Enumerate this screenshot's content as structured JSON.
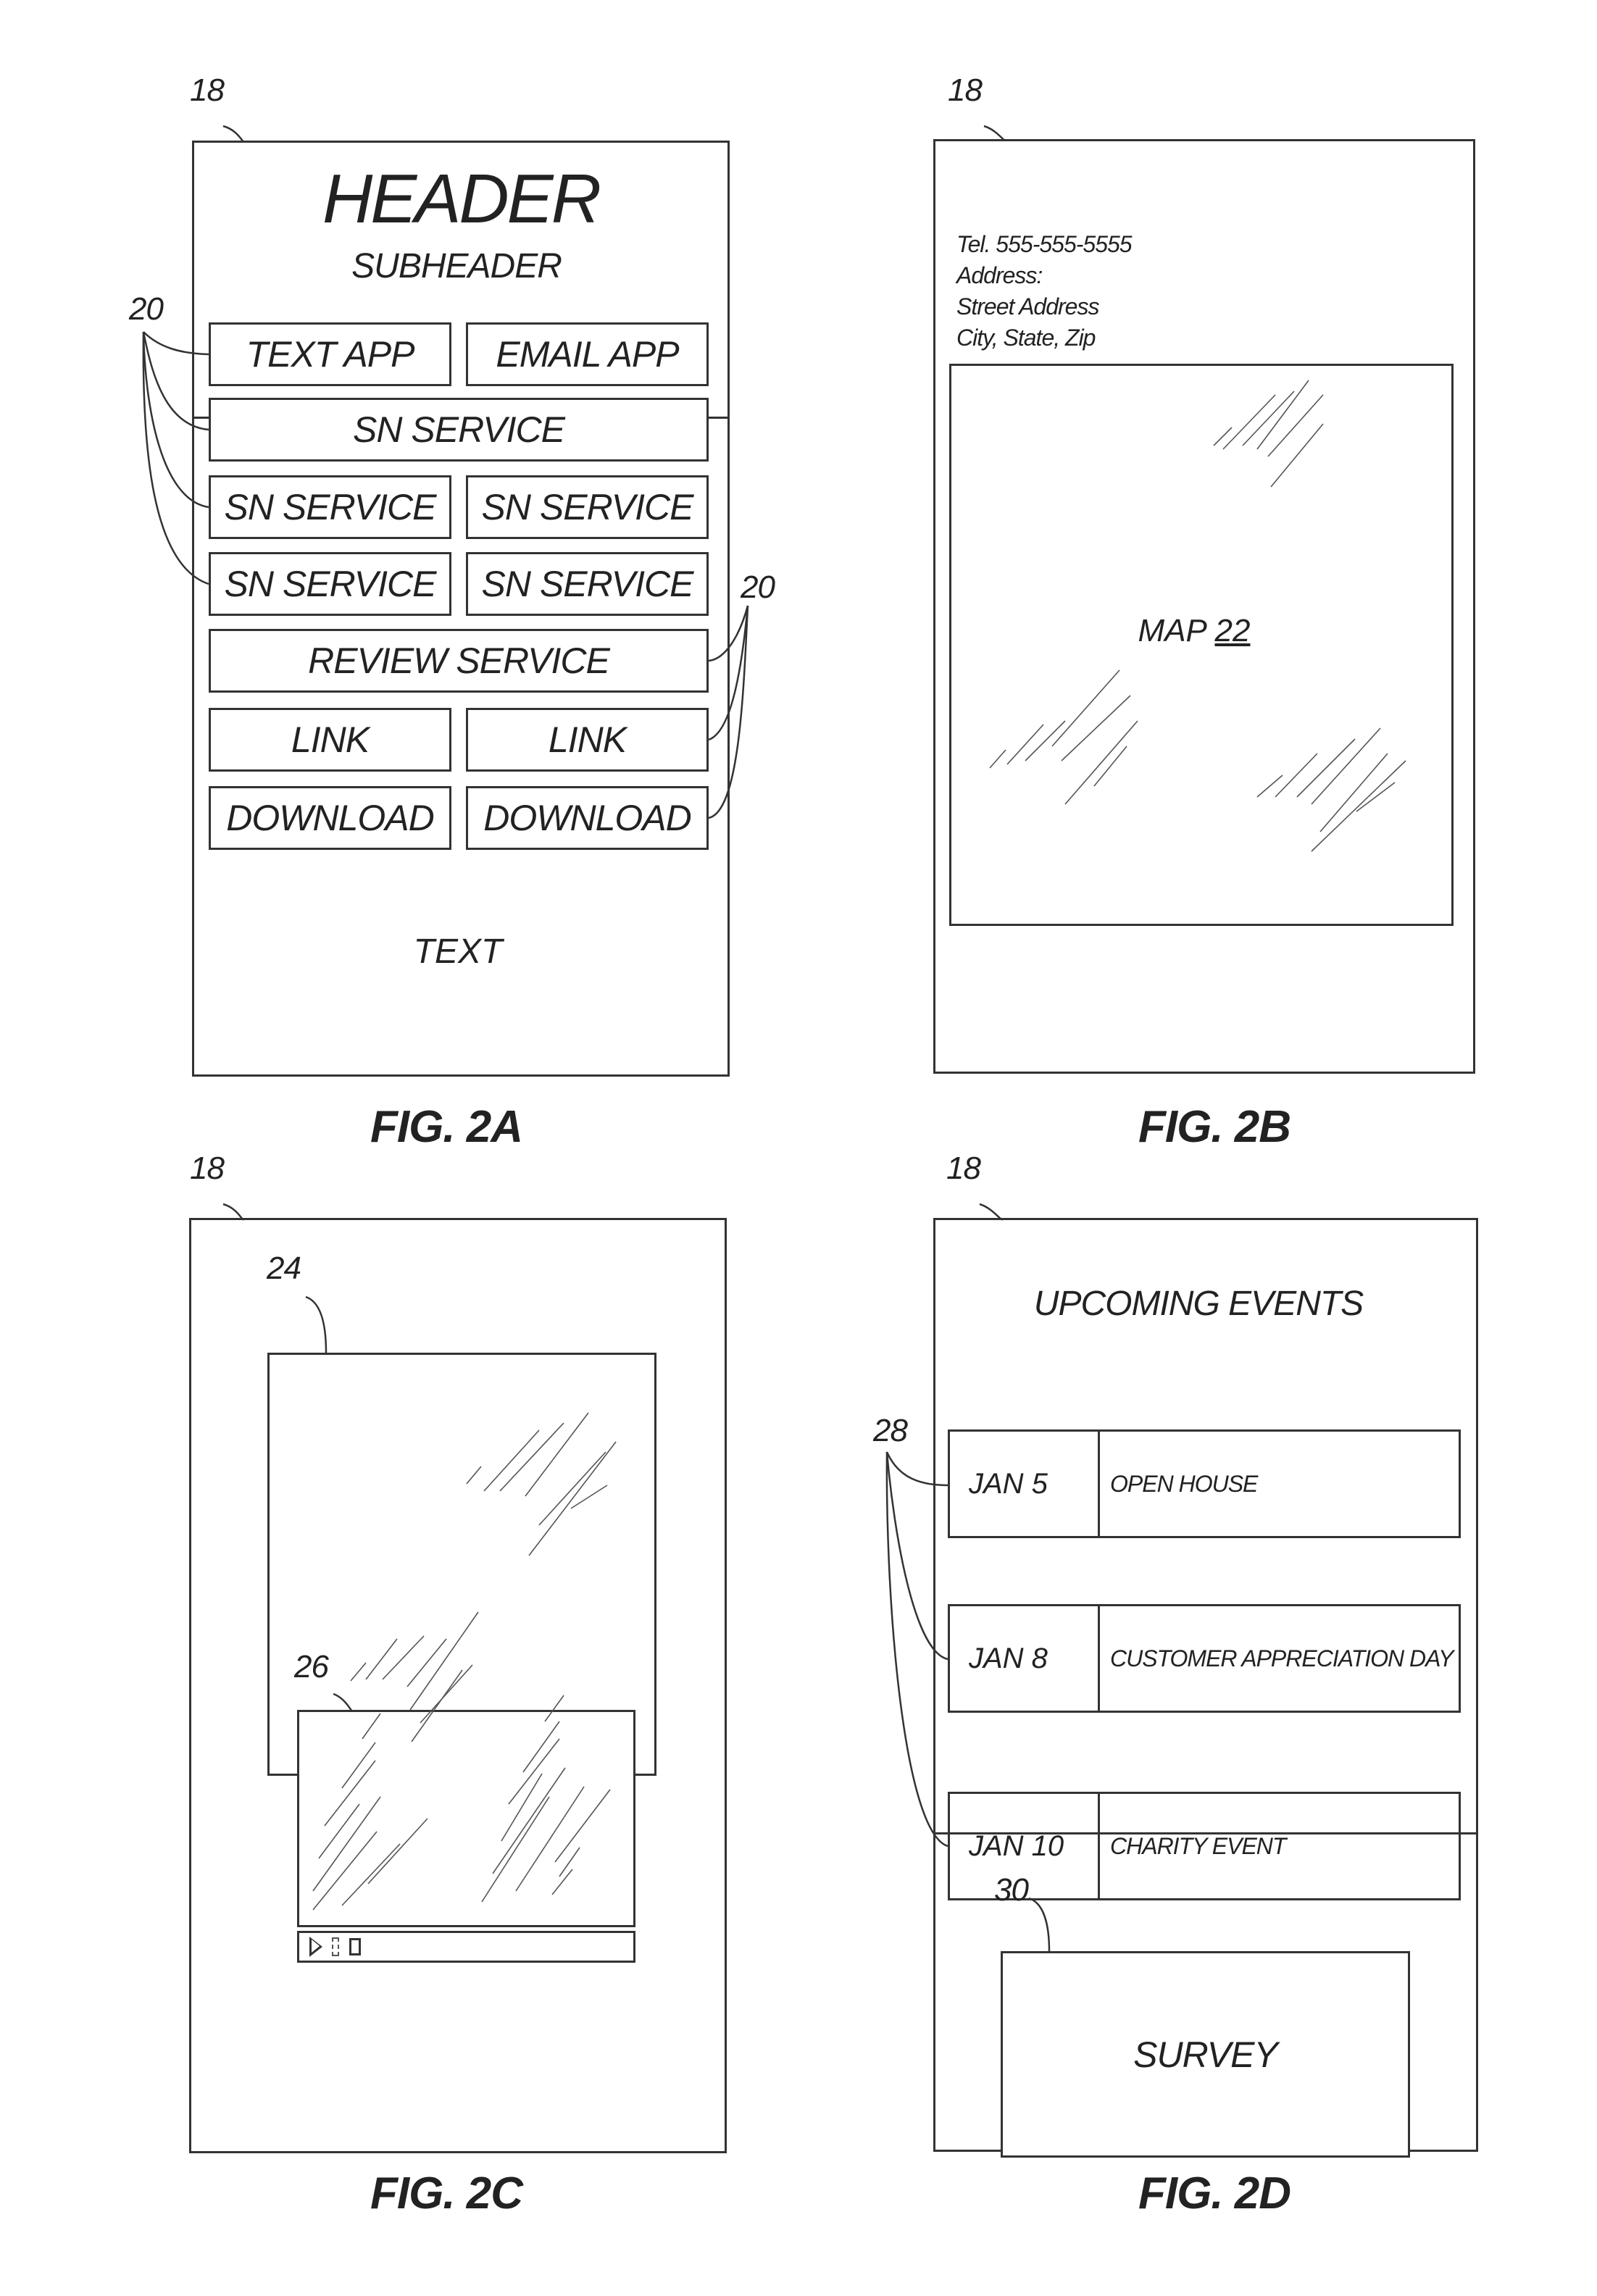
{
  "figures": {
    "fig2a": {
      "caption": "FIG. 2A",
      "ref_screen": "18",
      "ref_buttons_left": "20",
      "ref_buttons_right": "20",
      "header": "HEADER",
      "subheader": "SUBHEADER",
      "buttons": {
        "text_app": "TEXT APP",
        "email_app": "EMAIL APP",
        "sn_service_full": "SN SERVICE",
        "sn_service_1": "SN SERVICE",
        "sn_service_2": "SN SERVICE",
        "sn_service_3": "SN SERVICE",
        "sn_service_4": "SN SERVICE",
        "review_service": "REVIEW SERVICE",
        "link_1": "LINK",
        "link_2": "LINK",
        "download_1": "DOWNLOAD",
        "download_2": "DOWNLOAD"
      },
      "footer_text": "TEXT"
    },
    "fig2b": {
      "caption": "FIG. 2B",
      "ref_screen": "18",
      "contact": {
        "tel": "Tel. 555-555-5555",
        "address_label": "Address:",
        "street": "Street Address",
        "city_state_zip": "City, State, Zip"
      },
      "map_label": "MAP",
      "map_ref": "22"
    },
    "fig2c": {
      "caption": "FIG. 2C",
      "ref_screen": "18",
      "ref_image": "24",
      "ref_video": "26",
      "video_controls": [
        "play-icon",
        "pause-icon",
        "stop-icon"
      ]
    },
    "fig2d": {
      "caption": "FIG. 2D",
      "ref_screen": "18",
      "ref_events": "28",
      "ref_survey": "30",
      "title": "UPCOMING EVENTS",
      "events": [
        {
          "date": "JAN 5",
          "title": "OPEN HOUSE"
        },
        {
          "date": "JAN 8",
          "title": "CUSTOMER APPRECIATION DAY"
        },
        {
          "date": "JAN 10",
          "title": "CHARITY EVENT"
        }
      ],
      "survey_label": "SURVEY"
    }
  }
}
